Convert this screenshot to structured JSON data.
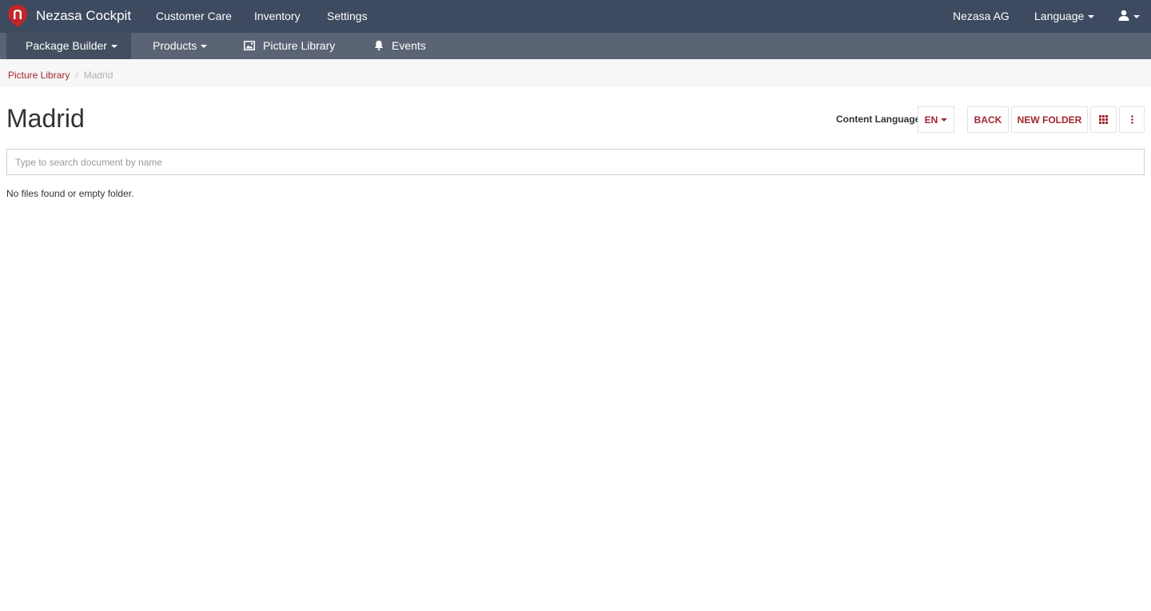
{
  "app": {
    "name": "Nezasa Cockpit",
    "logo_color": "#c0272d"
  },
  "topnav": {
    "items": [
      "Customer Care",
      "Inventory",
      "Settings"
    ],
    "company": "Nezasa AG",
    "language_label": "Language"
  },
  "subnav": {
    "package_builder": "Package Builder",
    "products": "Products",
    "picture_library": "Picture Library",
    "events": "Events"
  },
  "breadcrumb": {
    "parent": "Picture Library",
    "separator": "/",
    "current": "Madrid"
  },
  "page": {
    "title": "Madrid"
  },
  "toolbar": {
    "content_language_label": "Content Language",
    "language_value": "EN",
    "back_label": "BACK",
    "new_folder_label": "NEW FOLDER"
  },
  "search": {
    "placeholder": "Type to search document by name",
    "value": ""
  },
  "empty_message": "No files found or empty folder.",
  "colors": {
    "topbar": "#3d4a5f",
    "subbar": "#5a6474",
    "accent": "#a3262e"
  }
}
